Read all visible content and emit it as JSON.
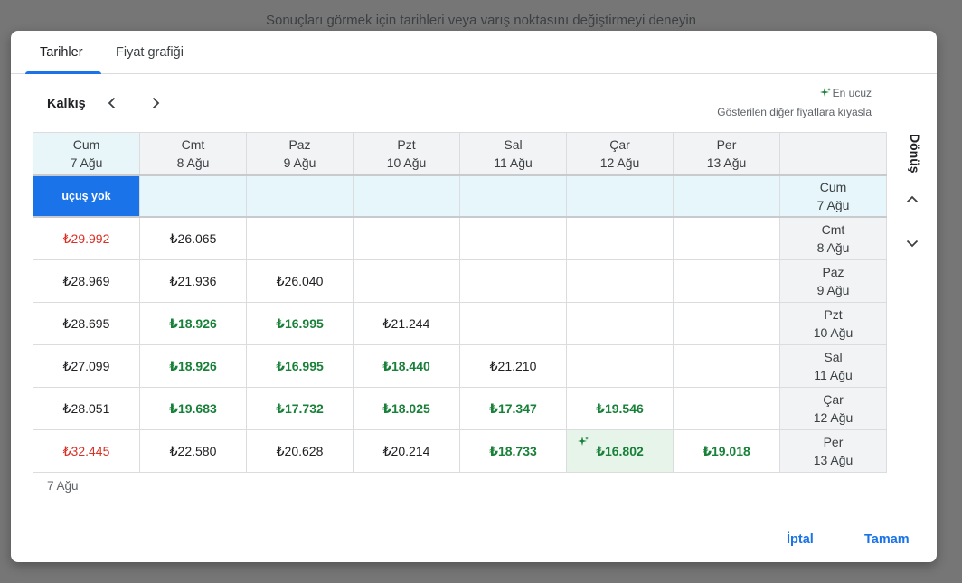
{
  "background": {
    "hint": "Sonuçları görmek için tarihleri veya varış noktasını değiştirmeyi deneyin"
  },
  "tabs": [
    {
      "label": "Tarihler"
    },
    {
      "label": "Fiyat grafiği"
    }
  ],
  "nav": {
    "label": "Kalkış"
  },
  "legend": {
    "cheapest": "En ucuz",
    "compare": "Gösterilen diğer fiyatlara kıyasla"
  },
  "side": {
    "label": "Dönüş"
  },
  "columns": [
    {
      "day": "Cum",
      "date": "7 Ağu"
    },
    {
      "day": "Cmt",
      "date": "8 Ağu"
    },
    {
      "day": "Paz",
      "date": "9 Ağu"
    },
    {
      "day": "Pzt",
      "date": "10 Ağu"
    },
    {
      "day": "Sal",
      "date": "11 Ağu"
    },
    {
      "day": "Çar",
      "date": "12 Ağu"
    },
    {
      "day": "Per",
      "date": "13 Ağu"
    }
  ],
  "no_flight": "uçuş yok",
  "rows": [
    {
      "day": "Cum",
      "date": "7 Ağu",
      "cells": [
        {
          "t": "noflight"
        }
      ]
    },
    {
      "day": "Cmt",
      "date": "8 Ağu",
      "cells": [
        {
          "v": "₺29.992",
          "s": "red"
        },
        {
          "v": "₺26.065",
          "s": ""
        }
      ]
    },
    {
      "day": "Paz",
      "date": "9 Ağu",
      "cells": [
        {
          "v": "₺28.969",
          "s": ""
        },
        {
          "v": "₺21.936",
          "s": ""
        },
        {
          "v": "₺26.040",
          "s": ""
        }
      ]
    },
    {
      "day": "Pzt",
      "date": "10 Ağu",
      "cells": [
        {
          "v": "₺28.695",
          "s": ""
        },
        {
          "v": "₺18.926",
          "s": "green"
        },
        {
          "v": "₺16.995",
          "s": "green"
        },
        {
          "v": "₺21.244",
          "s": ""
        }
      ]
    },
    {
      "day": "Sal",
      "date": "11 Ağu",
      "cells": [
        {
          "v": "₺27.099",
          "s": ""
        },
        {
          "v": "₺18.926",
          "s": "green"
        },
        {
          "v": "₺16.995",
          "s": "green"
        },
        {
          "v": "₺18.440",
          "s": "green"
        },
        {
          "v": "₺21.210",
          "s": ""
        }
      ]
    },
    {
      "day": "Çar",
      "date": "12 Ağu",
      "cells": [
        {
          "v": "₺28.051",
          "s": ""
        },
        {
          "v": "₺19.683",
          "s": "green"
        },
        {
          "v": "₺17.732",
          "s": "green"
        },
        {
          "v": "₺18.025",
          "s": "green"
        },
        {
          "v": "₺17.347",
          "s": "green"
        },
        {
          "v": "₺19.546",
          "s": "green"
        }
      ]
    },
    {
      "day": "Per",
      "date": "13 Ağu",
      "cells": [
        {
          "v": "₺32.445",
          "s": "red"
        },
        {
          "v": "₺22.580",
          "s": ""
        },
        {
          "v": "₺20.628",
          "s": ""
        },
        {
          "v": "₺20.214",
          "s": ""
        },
        {
          "v": "₺18.733",
          "s": "green"
        },
        {
          "v": "₺16.802",
          "s": "green",
          "cheapest": true
        },
        {
          "v": "₺19.018",
          "s": "green"
        }
      ]
    }
  ],
  "selection": {
    "label": "7 Ağu"
  },
  "buttons": {
    "cancel": "İptal",
    "ok": "Tamam"
  },
  "colors": {
    "accent": "#1a73e8",
    "cheap": "#188038",
    "expensive": "#d93025",
    "cheapest_bg": "#e6f4ea"
  }
}
